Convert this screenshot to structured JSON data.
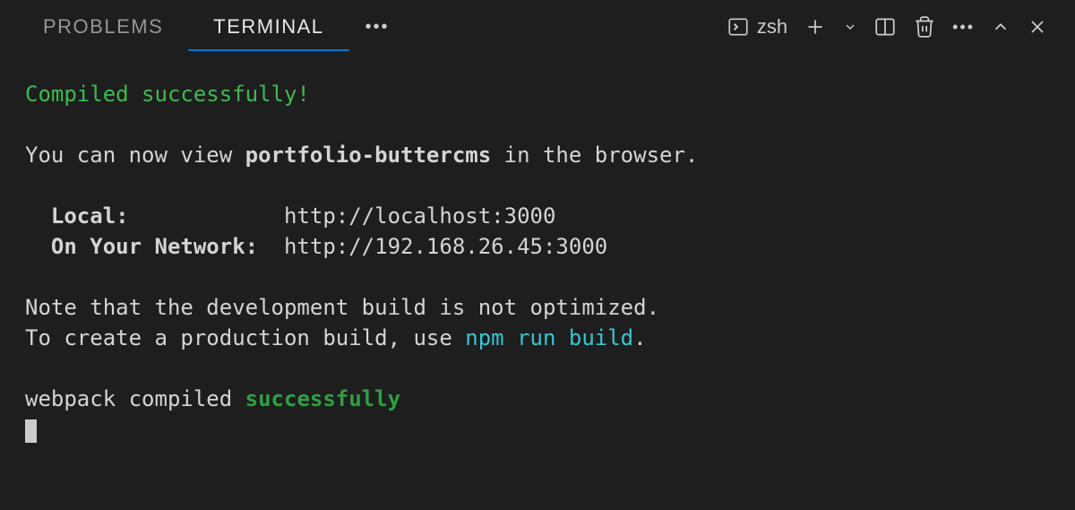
{
  "tabs": {
    "problems": "PROBLEMS",
    "terminal": "TERMINAL"
  },
  "toolbar": {
    "shell": "zsh"
  },
  "terminal": {
    "compiled_header": "Compiled successfully!",
    "view_prefix": "You can now view ",
    "project_name": "portfolio-buttercms",
    "view_suffix": " in the browser.",
    "local_label": "  Local:            ",
    "local_url": "http://localhost:3000",
    "network_label": "  On Your Network:  ",
    "network_url": "http://192.168.26.45:3000",
    "note_line1": "Note that the development build is not optimized.",
    "note_line2_prefix": "To create a production build, use ",
    "note_line2_cmd": "npm run build",
    "note_line2_suffix": ".",
    "webpack_prefix": "webpack compiled ",
    "webpack_status": "successfully"
  }
}
